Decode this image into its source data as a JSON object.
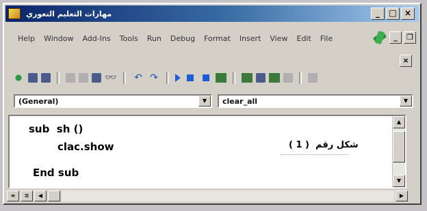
{
  "window": {
    "title": "مهارات التعليم التعوري"
  },
  "title_buttons": {
    "minimize": "_",
    "maximize": "□",
    "close": "×"
  },
  "menu": {
    "items": [
      "Help",
      "Window",
      "Add-Ins",
      "Tools",
      "Run",
      "Debug",
      "Format",
      "Insert",
      "View",
      "Edit",
      "File"
    ],
    "mdi_minimize": "_",
    "mdi_restore": "❐",
    "mdi_close": "×"
  },
  "toolbar": {
    "icons": [
      "vb-project-icon",
      "add-form-icon",
      "save-icon",
      "cut-icon",
      "copy-icon",
      "paste-icon",
      "find-icon",
      "undo-icon",
      "redo-icon",
      "run-icon",
      "break-icon",
      "end-icon",
      "design-mode-icon",
      "project-explorer-icon",
      "properties-icon",
      "object-browser-icon",
      "toolbox-icon",
      "data-view-icon"
    ]
  },
  "code_window": {
    "object_combo": "(General)",
    "procedure_combo": "clear_all",
    "lines": [
      "sub  sh ()",
      "clac.show",
      "End sub"
    ],
    "caption": "شكل رقم  ( 1 )"
  },
  "colors": {
    "titlebar_start": "#0a246a",
    "titlebar_end": "#a6caf0",
    "face": "#d4d0c8"
  }
}
